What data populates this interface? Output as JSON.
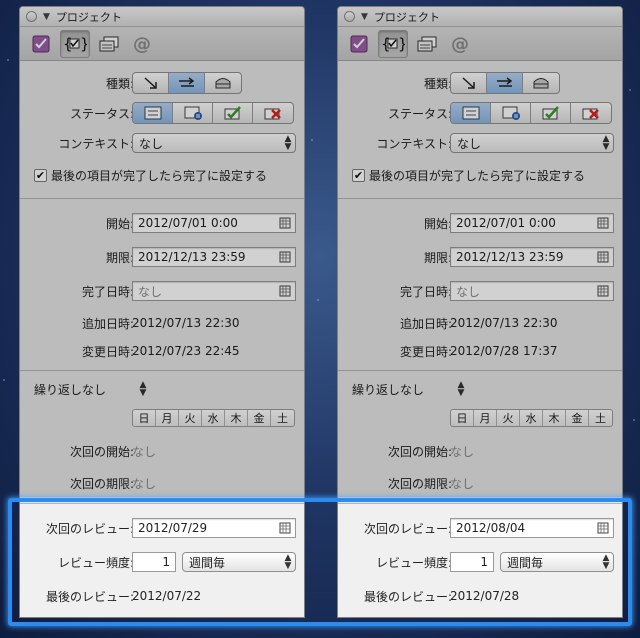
{
  "window": {
    "title": "プロジェクト"
  },
  "toolbar": {
    "icons": [
      "checkbox-icon",
      "context-brace-icon",
      "notes-icon",
      "attachment-icon"
    ]
  },
  "labels": {
    "type": "種類:",
    "status": "ステータス:",
    "context": "コンテキスト:",
    "complete_with_last": "最後の項目が完了したら完了に設定する",
    "start": "開始:",
    "due": "期限:",
    "completed": "完了日時:",
    "added": "追加日時:",
    "modified": "変更日時:",
    "repeat": "繰り返しなし",
    "next_start": "次回の開始:",
    "next_due": "次回の期限:",
    "next_review": "次回のレビュー:",
    "review_freq": "レビュー頻度:",
    "last_review": "最後のレビュー:"
  },
  "weekdays": [
    "日",
    "月",
    "火",
    "水",
    "木",
    "金",
    "土"
  ],
  "colors": {
    "highlight": "#2a8cf0",
    "segment_selected": "#9dc2ea"
  },
  "panels": [
    {
      "context": "なし",
      "start": "2012/07/01 0:00",
      "due": "2012/12/13 23:59",
      "completed_placeholder": "なし",
      "added": "2012/07/13 22:30",
      "modified": "2012/07/23 22:45",
      "next_start": "なし",
      "next_due": "なし",
      "next_review": "2012/07/29",
      "review_num": "1",
      "review_unit": "週間毎",
      "last_review": "2012/07/22"
    },
    {
      "context": "なし",
      "start": "2012/07/01 0:00",
      "due": "2012/12/13 23:59",
      "completed_placeholder": "なし",
      "added": "2012/07/13 22:30",
      "modified": "2012/07/28 17:37",
      "next_start": "なし",
      "next_due": "なし",
      "next_review": "2012/08/04",
      "review_num": "1",
      "review_unit": "週間毎",
      "last_review": "2012/07/28"
    }
  ]
}
